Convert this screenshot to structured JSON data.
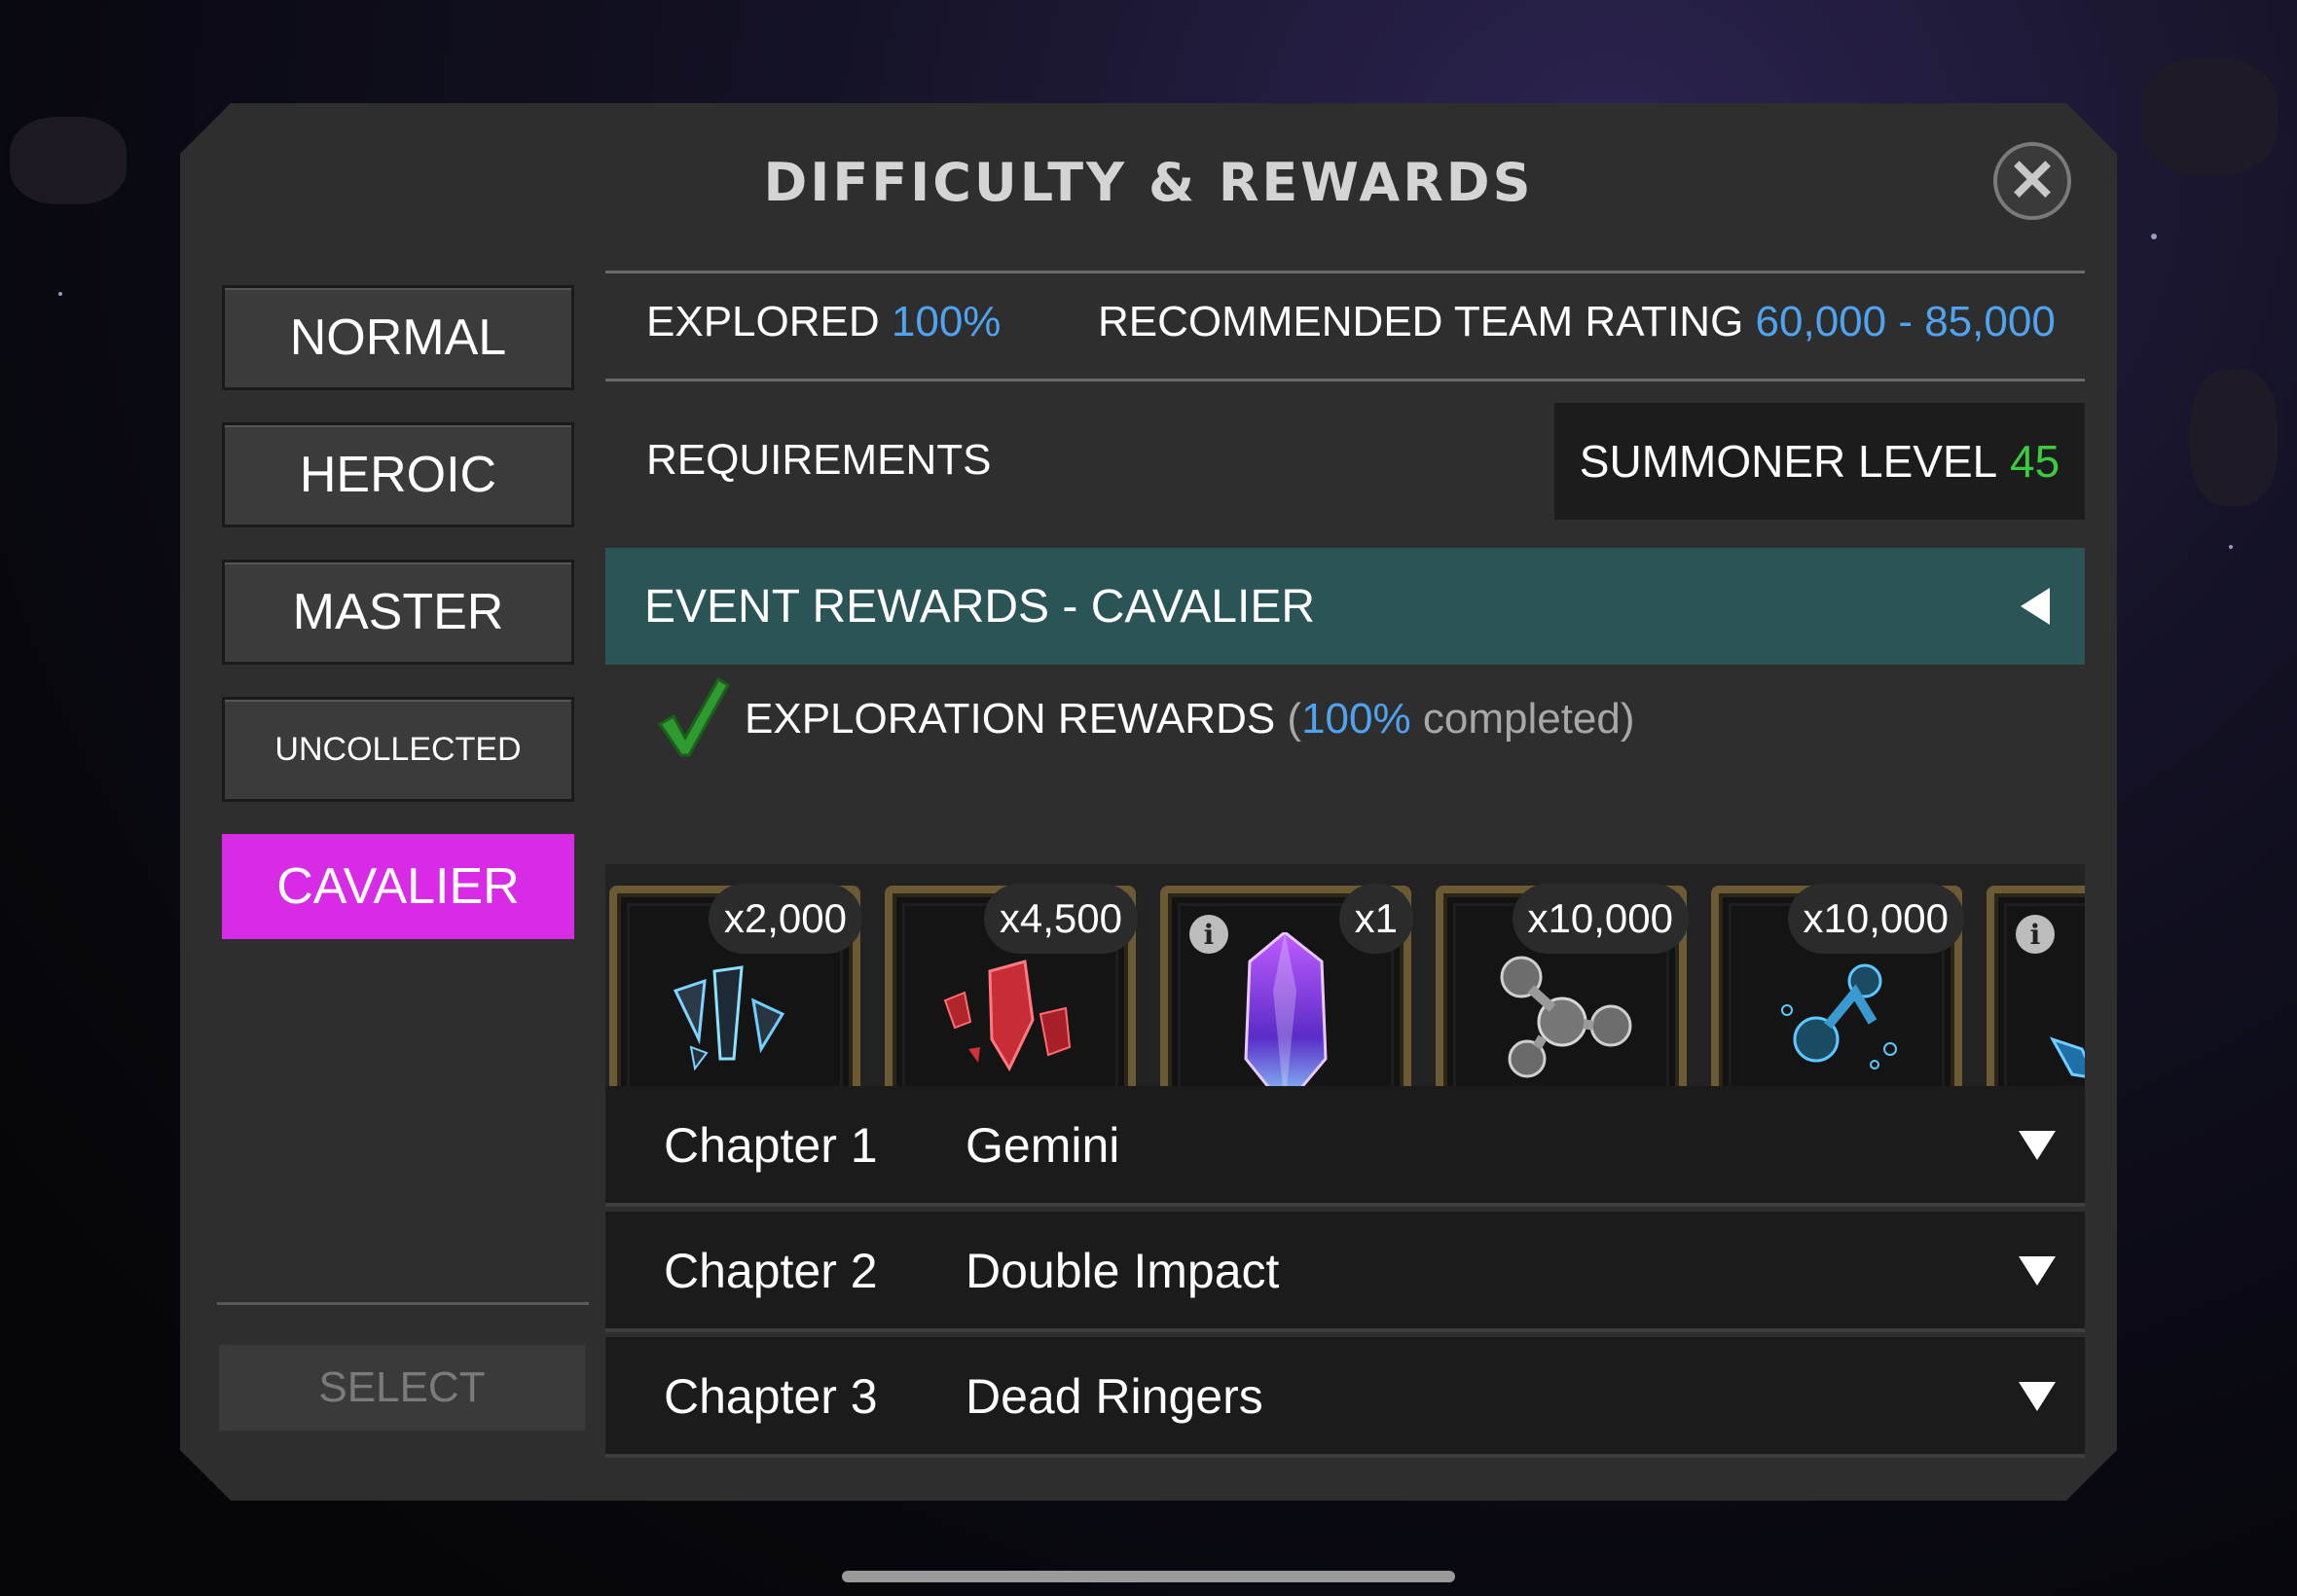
{
  "dialog": {
    "title": "DIFFICULTY & REWARDS",
    "close_icon": "close-icon"
  },
  "difficulty_tabs": [
    {
      "label": "NORMAL",
      "active": false
    },
    {
      "label": "HEROIC",
      "active": false
    },
    {
      "label": "MASTER",
      "active": false
    },
    {
      "label": "UNCOLLECTED",
      "active": false
    },
    {
      "label": "CAVALIER",
      "active": true
    }
  ],
  "select_label": "SELECT",
  "stats": {
    "explored_label": "EXPLORED",
    "explored_value": "100%",
    "rating_label": "RECOMMENDED TEAM RATING",
    "rating_value": "60,000 - 85,000"
  },
  "requirements": {
    "label": "REQUIREMENTS",
    "summoner_label": "SUMMONER LEVEL",
    "summoner_value": "45"
  },
  "event_rewards": {
    "label": "EVENT REWARDS - CAVALIER",
    "exploration_label": "EXPLORATION REWARDS",
    "paren_open": "(",
    "completion_pct": "100%",
    "completion_text": "completed)"
  },
  "rewards": [
    {
      "qty": "x2,000",
      "icon": "shards-icon",
      "info": false
    },
    {
      "qty": "x4,500",
      "icon": "red-crystal-shards-icon",
      "info": false
    },
    {
      "qty": "x1",
      "icon": "purple-crystal-icon",
      "info": true,
      "info_glyph": "i"
    },
    {
      "qty": "x10,000",
      "icon": "grey-catalyst-icon",
      "info": false
    },
    {
      "qty": "x10,000",
      "icon": "blue-catalyst-icon",
      "info": false
    },
    {
      "qty": "",
      "icon": "blue-shard-icon",
      "info": true,
      "info_glyph": "i"
    }
  ],
  "chapters": [
    {
      "number": "Chapter 1",
      "name": "Gemini"
    },
    {
      "number": "Chapter 2",
      "name": "Double Impact"
    },
    {
      "number": "Chapter 3",
      "name": "Dead Ringers"
    }
  ],
  "colors": {
    "accent_active": "#d82be6",
    "event_bar": "#2a5456",
    "highlight_blue": "#4fa3f0",
    "highlight_green": "#3ccb3c"
  }
}
